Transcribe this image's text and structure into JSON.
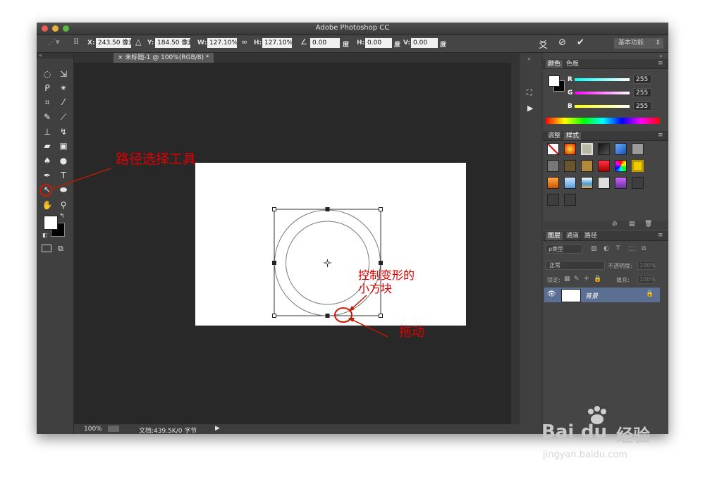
{
  "app": {
    "title": "Adobe Photoshop CC"
  },
  "options_bar": {
    "x_label": "X:",
    "x_value": "243.50 像素",
    "y_label": "Y:",
    "y_value": "184.50 像素",
    "w_label": "W:",
    "w_value": "127.10%",
    "h_label": "H:",
    "h_value": "127.10%",
    "angle_value": "0.00",
    "angle_unit": "度",
    "hskew_label": "H:",
    "hskew_value": "0.00",
    "hskew_unit": "度",
    "vskew_label": "V:",
    "vskew_value": "0.00",
    "vskew_unit": "度",
    "workspace": "基本功能"
  },
  "document": {
    "tab_label": "未标题-1 @ 100%(RGB/8) *",
    "zoom": "100%",
    "doc_info": "文档:439.5K/0 字节"
  },
  "color_panel": {
    "tabs": [
      "颜色",
      "色板"
    ],
    "channels": [
      {
        "label": "R",
        "value": "255",
        "color": "#00e5e5"
      },
      {
        "label": "G",
        "value": "255",
        "color": "#e000e0"
      },
      {
        "label": "B",
        "value": "255",
        "color": "#e8e800"
      }
    ]
  },
  "styles_panel": {
    "tabs": [
      "调整",
      "样式"
    ]
  },
  "layers_panel": {
    "tabs": [
      "图层",
      "通道",
      "路径"
    ],
    "filter_kind": "ρ类型",
    "blend_mode": "正常",
    "opacity_label": "不透明度:",
    "opacity_value": "100%",
    "lock_label": "锁定:",
    "fill_label": "填充:",
    "fill_value": "100%",
    "layers": [
      {
        "name": "背景"
      }
    ]
  },
  "annotations": {
    "path_select_tool": "路径选择工具",
    "transform_handle_line1": "控制变形的",
    "transform_handle_line2": "小方块",
    "drag": "拖动"
  },
  "watermark": {
    "brand_a": "Bai",
    "brand_b": "du",
    "brand_c": "经验",
    "url": "jingyan.baidu.com"
  },
  "colors": {
    "annotation_red": "#e00000",
    "layer_selected": "#5b6f92"
  }
}
